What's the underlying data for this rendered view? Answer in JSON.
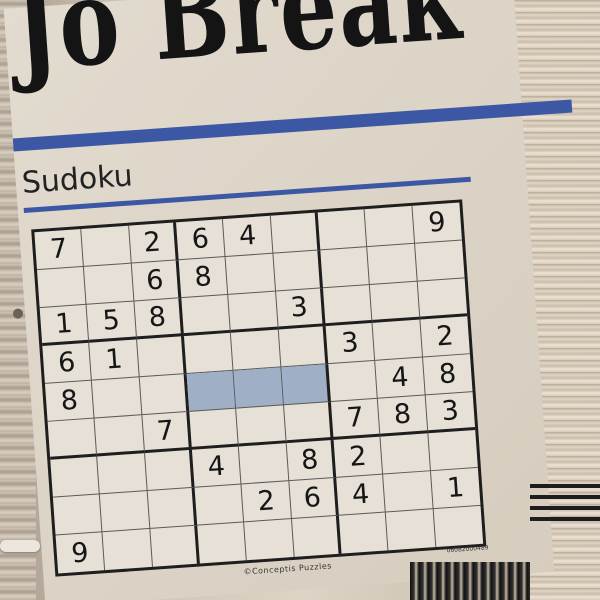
{
  "masthead": {
    "text": "Jo Break"
  },
  "section": {
    "title": "Sudoku"
  },
  "puzzle": {
    "rows": [
      [
        "7",
        "",
        "2",
        "6",
        "4",
        "",
        "",
        "",
        "9"
      ],
      [
        "",
        "",
        "6",
        "8",
        "",
        "",
        "",
        "",
        ""
      ],
      [
        "1",
        "5",
        "8",
        "",
        "",
        "3",
        "",
        "",
        ""
      ],
      [
        "6",
        "1",
        "",
        "",
        "",
        "",
        "3",
        "",
        "2"
      ],
      [
        "8",
        "",
        "",
        "",
        "",
        "",
        "",
        "4",
        "8"
      ],
      [
        "",
        "",
        "7",
        "",
        "",
        "",
        "7",
        "8",
        "3"
      ],
      [
        "",
        "",
        "",
        "4",
        "",
        "8",
        "2",
        "",
        ""
      ],
      [
        "",
        "",
        "",
        "",
        "2",
        "6",
        "4",
        "",
        "1"
      ],
      [
        "9",
        "",
        "",
        "",
        "",
        "",
        "",
        "",
        ""
      ]
    ],
    "shaded_cells": [
      [
        4,
        3
      ],
      [
        4,
        4
      ],
      [
        4,
        5
      ]
    ],
    "credit": "©Conceptis Puzzles",
    "code": "06082000489"
  },
  "colors": {
    "rule_blue": "#3c57a3",
    "shade_blue": "#9fb0c6",
    "paper": "#ddd5c8"
  }
}
